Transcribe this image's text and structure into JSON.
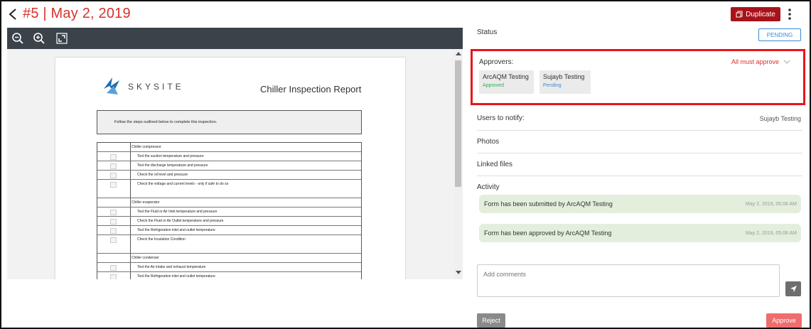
{
  "header": {
    "title": "#5 | May 2, 2019",
    "duplicate_label": "Duplicate"
  },
  "viewer": {
    "toolbar": [
      "zoom-out",
      "zoom-in",
      "fit-to-screen"
    ],
    "document": {
      "brand": "SKYSITE",
      "title": "Chiller Inspection Report",
      "instructions": "Follow the steps outlined below to complete this inspection.",
      "sections": [
        {
          "name": "Chiller compressor",
          "items": [
            "Test the suction temperature and pressure",
            "Test the discharge temperature and pressure",
            "Check the oil level and pressure",
            "Check the voltage and current levels - only if safe to do so"
          ]
        },
        {
          "name": "Chiller evaporator",
          "items": [
            "Test the Fluid or Air Inlet temperature and pressure",
            "Check the Fluid or Air Outlet temperature and pressure",
            "Test the Refrigeration inlet and outlet temperature",
            "Check the Insulation Condition"
          ]
        },
        {
          "name": "Chiller condenser",
          "items": [
            "Test the Air intake and exhaust temperature",
            "Test the Refrigeration inlet and outlet temperature"
          ]
        }
      ]
    }
  },
  "panel": {
    "status_label": "Status",
    "status_value": "PENDING",
    "approvers_label": "Approvers:",
    "approval_rule": "All must approve",
    "approvers": [
      {
        "name": "ArcAQM Testing",
        "status": "Approved",
        "status_color": "#2fae5a"
      },
      {
        "name": "Sujayb Testing",
        "status": "Pending",
        "status_color": "#3a8ad8"
      }
    ],
    "notify_label": "Users to notify:",
    "notify_value": "Sujayb Testing",
    "photos_label": "Photos",
    "linked_files_label": "Linked files",
    "activity_label": "Activity",
    "activity": [
      {
        "text": "Form has been submitted by ArcAQM Testing",
        "time": "May 2, 2019, 05:08 AM"
      },
      {
        "text": "Form has been approved by ArcAQM Testing",
        "time": "May 2, 2019, 05:08 AM"
      }
    ],
    "comments_placeholder": "Add comments",
    "reject_label": "Reject",
    "approve_label": "Approve"
  },
  "colors": {
    "accent": "#d9302b",
    "duplicate_bg": "#a8121a",
    "pending_blue": "#3a8ad8",
    "approved_green": "#2fae5a",
    "activity_bg": "#e4eedd",
    "approve_bg": "#ef6d6d",
    "toolbar_bg": "#3b4249"
  }
}
